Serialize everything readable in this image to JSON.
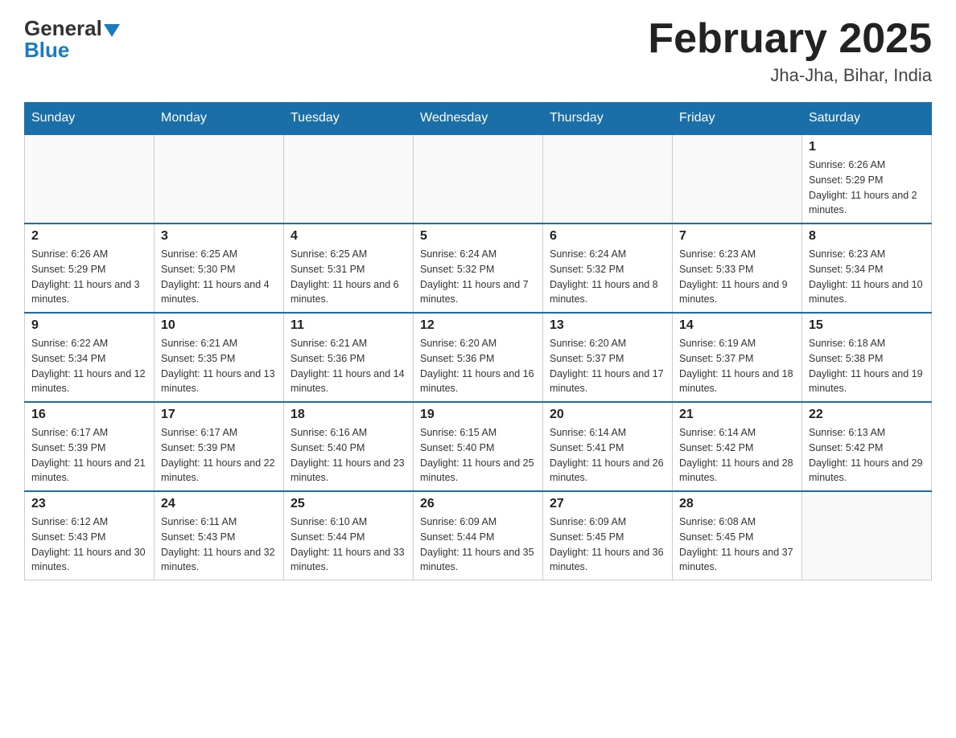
{
  "header": {
    "logo_general": "General",
    "logo_blue": "Blue",
    "month_title": "February 2025",
    "location": "Jha-Jha, Bihar, India"
  },
  "days_of_week": [
    "Sunday",
    "Monday",
    "Tuesday",
    "Wednesday",
    "Thursday",
    "Friday",
    "Saturday"
  ],
  "weeks": [
    [
      {
        "day": "",
        "sunrise": "",
        "sunset": "",
        "daylight": ""
      },
      {
        "day": "",
        "sunrise": "",
        "sunset": "",
        "daylight": ""
      },
      {
        "day": "",
        "sunrise": "",
        "sunset": "",
        "daylight": ""
      },
      {
        "day": "",
        "sunrise": "",
        "sunset": "",
        "daylight": ""
      },
      {
        "day": "",
        "sunrise": "",
        "sunset": "",
        "daylight": ""
      },
      {
        "day": "",
        "sunrise": "",
        "sunset": "",
        "daylight": ""
      },
      {
        "day": "1",
        "sunrise": "Sunrise: 6:26 AM",
        "sunset": "Sunset: 5:29 PM",
        "daylight": "Daylight: 11 hours and 2 minutes."
      }
    ],
    [
      {
        "day": "2",
        "sunrise": "Sunrise: 6:26 AM",
        "sunset": "Sunset: 5:29 PM",
        "daylight": "Daylight: 11 hours and 3 minutes."
      },
      {
        "day": "3",
        "sunrise": "Sunrise: 6:25 AM",
        "sunset": "Sunset: 5:30 PM",
        "daylight": "Daylight: 11 hours and 4 minutes."
      },
      {
        "day": "4",
        "sunrise": "Sunrise: 6:25 AM",
        "sunset": "Sunset: 5:31 PM",
        "daylight": "Daylight: 11 hours and 6 minutes."
      },
      {
        "day": "5",
        "sunrise": "Sunrise: 6:24 AM",
        "sunset": "Sunset: 5:32 PM",
        "daylight": "Daylight: 11 hours and 7 minutes."
      },
      {
        "day": "6",
        "sunrise": "Sunrise: 6:24 AM",
        "sunset": "Sunset: 5:32 PM",
        "daylight": "Daylight: 11 hours and 8 minutes."
      },
      {
        "day": "7",
        "sunrise": "Sunrise: 6:23 AM",
        "sunset": "Sunset: 5:33 PM",
        "daylight": "Daylight: 11 hours and 9 minutes."
      },
      {
        "day": "8",
        "sunrise": "Sunrise: 6:23 AM",
        "sunset": "Sunset: 5:34 PM",
        "daylight": "Daylight: 11 hours and 10 minutes."
      }
    ],
    [
      {
        "day": "9",
        "sunrise": "Sunrise: 6:22 AM",
        "sunset": "Sunset: 5:34 PM",
        "daylight": "Daylight: 11 hours and 12 minutes."
      },
      {
        "day": "10",
        "sunrise": "Sunrise: 6:21 AM",
        "sunset": "Sunset: 5:35 PM",
        "daylight": "Daylight: 11 hours and 13 minutes."
      },
      {
        "day": "11",
        "sunrise": "Sunrise: 6:21 AM",
        "sunset": "Sunset: 5:36 PM",
        "daylight": "Daylight: 11 hours and 14 minutes."
      },
      {
        "day": "12",
        "sunrise": "Sunrise: 6:20 AM",
        "sunset": "Sunset: 5:36 PM",
        "daylight": "Daylight: 11 hours and 16 minutes."
      },
      {
        "day": "13",
        "sunrise": "Sunrise: 6:20 AM",
        "sunset": "Sunset: 5:37 PM",
        "daylight": "Daylight: 11 hours and 17 minutes."
      },
      {
        "day": "14",
        "sunrise": "Sunrise: 6:19 AM",
        "sunset": "Sunset: 5:37 PM",
        "daylight": "Daylight: 11 hours and 18 minutes."
      },
      {
        "day": "15",
        "sunrise": "Sunrise: 6:18 AM",
        "sunset": "Sunset: 5:38 PM",
        "daylight": "Daylight: 11 hours and 19 minutes."
      }
    ],
    [
      {
        "day": "16",
        "sunrise": "Sunrise: 6:17 AM",
        "sunset": "Sunset: 5:39 PM",
        "daylight": "Daylight: 11 hours and 21 minutes."
      },
      {
        "day": "17",
        "sunrise": "Sunrise: 6:17 AM",
        "sunset": "Sunset: 5:39 PM",
        "daylight": "Daylight: 11 hours and 22 minutes."
      },
      {
        "day": "18",
        "sunrise": "Sunrise: 6:16 AM",
        "sunset": "Sunset: 5:40 PM",
        "daylight": "Daylight: 11 hours and 23 minutes."
      },
      {
        "day": "19",
        "sunrise": "Sunrise: 6:15 AM",
        "sunset": "Sunset: 5:40 PM",
        "daylight": "Daylight: 11 hours and 25 minutes."
      },
      {
        "day": "20",
        "sunrise": "Sunrise: 6:14 AM",
        "sunset": "Sunset: 5:41 PM",
        "daylight": "Daylight: 11 hours and 26 minutes."
      },
      {
        "day": "21",
        "sunrise": "Sunrise: 6:14 AM",
        "sunset": "Sunset: 5:42 PM",
        "daylight": "Daylight: 11 hours and 28 minutes."
      },
      {
        "day": "22",
        "sunrise": "Sunrise: 6:13 AM",
        "sunset": "Sunset: 5:42 PM",
        "daylight": "Daylight: 11 hours and 29 minutes."
      }
    ],
    [
      {
        "day": "23",
        "sunrise": "Sunrise: 6:12 AM",
        "sunset": "Sunset: 5:43 PM",
        "daylight": "Daylight: 11 hours and 30 minutes."
      },
      {
        "day": "24",
        "sunrise": "Sunrise: 6:11 AM",
        "sunset": "Sunset: 5:43 PM",
        "daylight": "Daylight: 11 hours and 32 minutes."
      },
      {
        "day": "25",
        "sunrise": "Sunrise: 6:10 AM",
        "sunset": "Sunset: 5:44 PM",
        "daylight": "Daylight: 11 hours and 33 minutes."
      },
      {
        "day": "26",
        "sunrise": "Sunrise: 6:09 AM",
        "sunset": "Sunset: 5:44 PM",
        "daylight": "Daylight: 11 hours and 35 minutes."
      },
      {
        "day": "27",
        "sunrise": "Sunrise: 6:09 AM",
        "sunset": "Sunset: 5:45 PM",
        "daylight": "Daylight: 11 hours and 36 minutes."
      },
      {
        "day": "28",
        "sunrise": "Sunrise: 6:08 AM",
        "sunset": "Sunset: 5:45 PM",
        "daylight": "Daylight: 11 hours and 37 minutes."
      },
      {
        "day": "",
        "sunrise": "",
        "sunset": "",
        "daylight": ""
      }
    ]
  ]
}
